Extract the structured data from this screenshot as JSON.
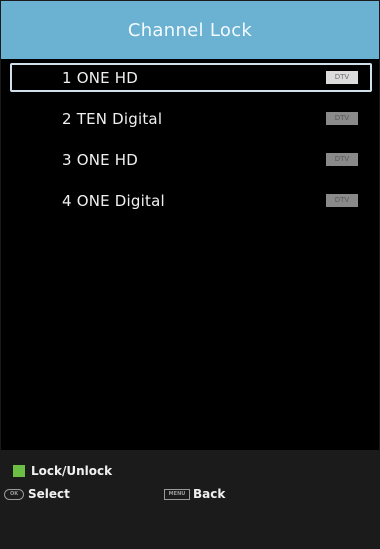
{
  "header": {
    "title": "Channel Lock"
  },
  "channels": [
    {
      "label": "1 ONE HD",
      "badge": "DTV",
      "selected": true
    },
    {
      "label": "2 TEN Digital",
      "badge": "DTV",
      "selected": false
    },
    {
      "label": "3 ONE HD",
      "badge": "DTV",
      "selected": false
    },
    {
      "label": "4 ONE Digital",
      "badge": "DTV",
      "selected": false
    }
  ],
  "footer": {
    "lock_label": "Lock/Unlock",
    "ok_icon_text": "OK",
    "select_label": "Select",
    "menu_icon_text": "MENU",
    "back_label": "Back",
    "green_key_icon": "green-square",
    "ok_icon": "ok-oval"
  },
  "colors": {
    "title_bar": "#6ab1d2",
    "selected_border": "#cfe0ec",
    "footer_bg": "#1b1b1b",
    "green_key": "#6dbe45"
  }
}
